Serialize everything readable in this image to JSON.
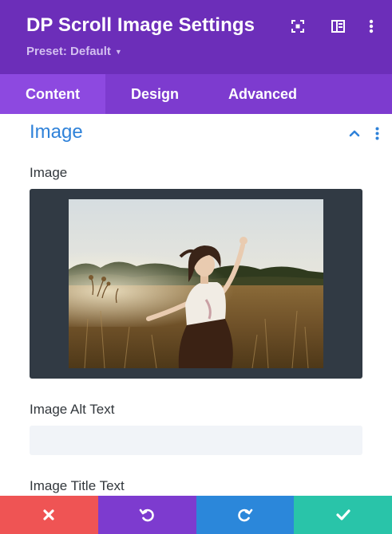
{
  "header": {
    "title": "DP Scroll Image Settings",
    "preset_label": "Preset: Default",
    "icons": [
      "focus-mode-icon",
      "split-view-icon",
      "more-vertical-icon"
    ]
  },
  "tabs": [
    {
      "label": "Content",
      "active": true
    },
    {
      "label": "Design",
      "active": false
    },
    {
      "label": "Advanced",
      "active": false
    }
  ],
  "section": {
    "title": "Image",
    "fields": {
      "image_label": "Image",
      "alt_label": "Image Alt Text",
      "alt_value": "",
      "title_label": "Image Title Text",
      "title_value": ""
    }
  },
  "footer": {
    "buttons": [
      {
        "name": "cancel",
        "icon": "close-icon",
        "color": "#ef5454"
      },
      {
        "name": "undo",
        "icon": "undo-icon",
        "color": "#7d3bcf"
      },
      {
        "name": "redo",
        "icon": "redo-icon",
        "color": "#2b87da"
      },
      {
        "name": "save",
        "icon": "check-icon",
        "color": "#29c4a9"
      }
    ]
  },
  "colors": {
    "header_bg": "#6c2eb9",
    "tabs_bg": "#7d3bcf",
    "active_tab_bg": "#8d49e0",
    "section_title": "#2f82d9",
    "image_box_bg": "#313a44",
    "field_bg": "#f1f4f8"
  }
}
